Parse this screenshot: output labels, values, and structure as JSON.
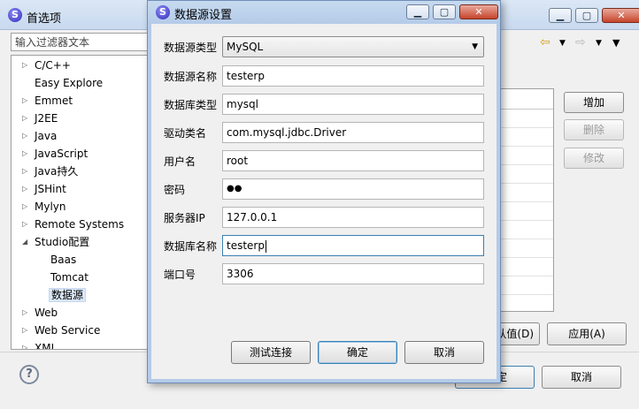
{
  "back_window": {
    "title": "首选项",
    "filter_placeholder": "输入过滤器文本",
    "tree": [
      {
        "label": "C/C++",
        "arrow": "▷"
      },
      {
        "label": "Easy Explore",
        "arrow": ""
      },
      {
        "label": "Emmet",
        "arrow": "▷"
      },
      {
        "label": "J2EE",
        "arrow": "▷"
      },
      {
        "label": "Java",
        "arrow": "▷"
      },
      {
        "label": "JavaScript",
        "arrow": "▷"
      },
      {
        "label": "Java持久",
        "arrow": "▷"
      },
      {
        "label": "JSHint",
        "arrow": "▷"
      },
      {
        "label": "Mylyn",
        "arrow": "▷"
      },
      {
        "label": "Remote Systems",
        "arrow": "▷"
      },
      {
        "label": "Studio配置",
        "arrow": "◢"
      },
      {
        "label": "Baas",
        "arrow": ""
      },
      {
        "label": "Tomcat",
        "arrow": ""
      },
      {
        "label": "数据源",
        "arrow": ""
      },
      {
        "label": "Web",
        "arrow": "▷"
      },
      {
        "label": "Web Service",
        "arrow": "▷"
      },
      {
        "label": "XML",
        "arrow": "▷"
      }
    ],
    "side_buttons": {
      "add": "增加",
      "delete": "删除",
      "edit": "修改"
    },
    "restore_defaults": "认值(D)",
    "apply": "应用(A)",
    "ok_partial": "定",
    "cancel": "取消",
    "help": "?"
  },
  "dialog": {
    "title": "数据源设置",
    "fields": {
      "ds_type": {
        "label": "数据源类型",
        "value": "MySQL"
      },
      "ds_name": {
        "label": "数据源名称",
        "value": "testerp"
      },
      "db_type": {
        "label": "数据库类型",
        "value": "mysql"
      },
      "driver": {
        "label": "驱动类名",
        "value": "com.mysql.jdbc.Driver"
      },
      "user": {
        "label": "用户名",
        "value": "root"
      },
      "password": {
        "label": "密码",
        "value": "●●"
      },
      "server_ip": {
        "label": "服务器IP",
        "value": "127.0.0.1"
      },
      "db_name": {
        "label": "数据库名称",
        "value": "testerp"
      },
      "port": {
        "label": "端口号",
        "value": "3306"
      }
    },
    "buttons": {
      "test": "测试连接",
      "ok": "确定",
      "cancel": "取消"
    }
  },
  "colors": {
    "titlebar": "#c7daf0",
    "selected": "#dbe8f8",
    "focus_border": "#3c7fb1"
  }
}
